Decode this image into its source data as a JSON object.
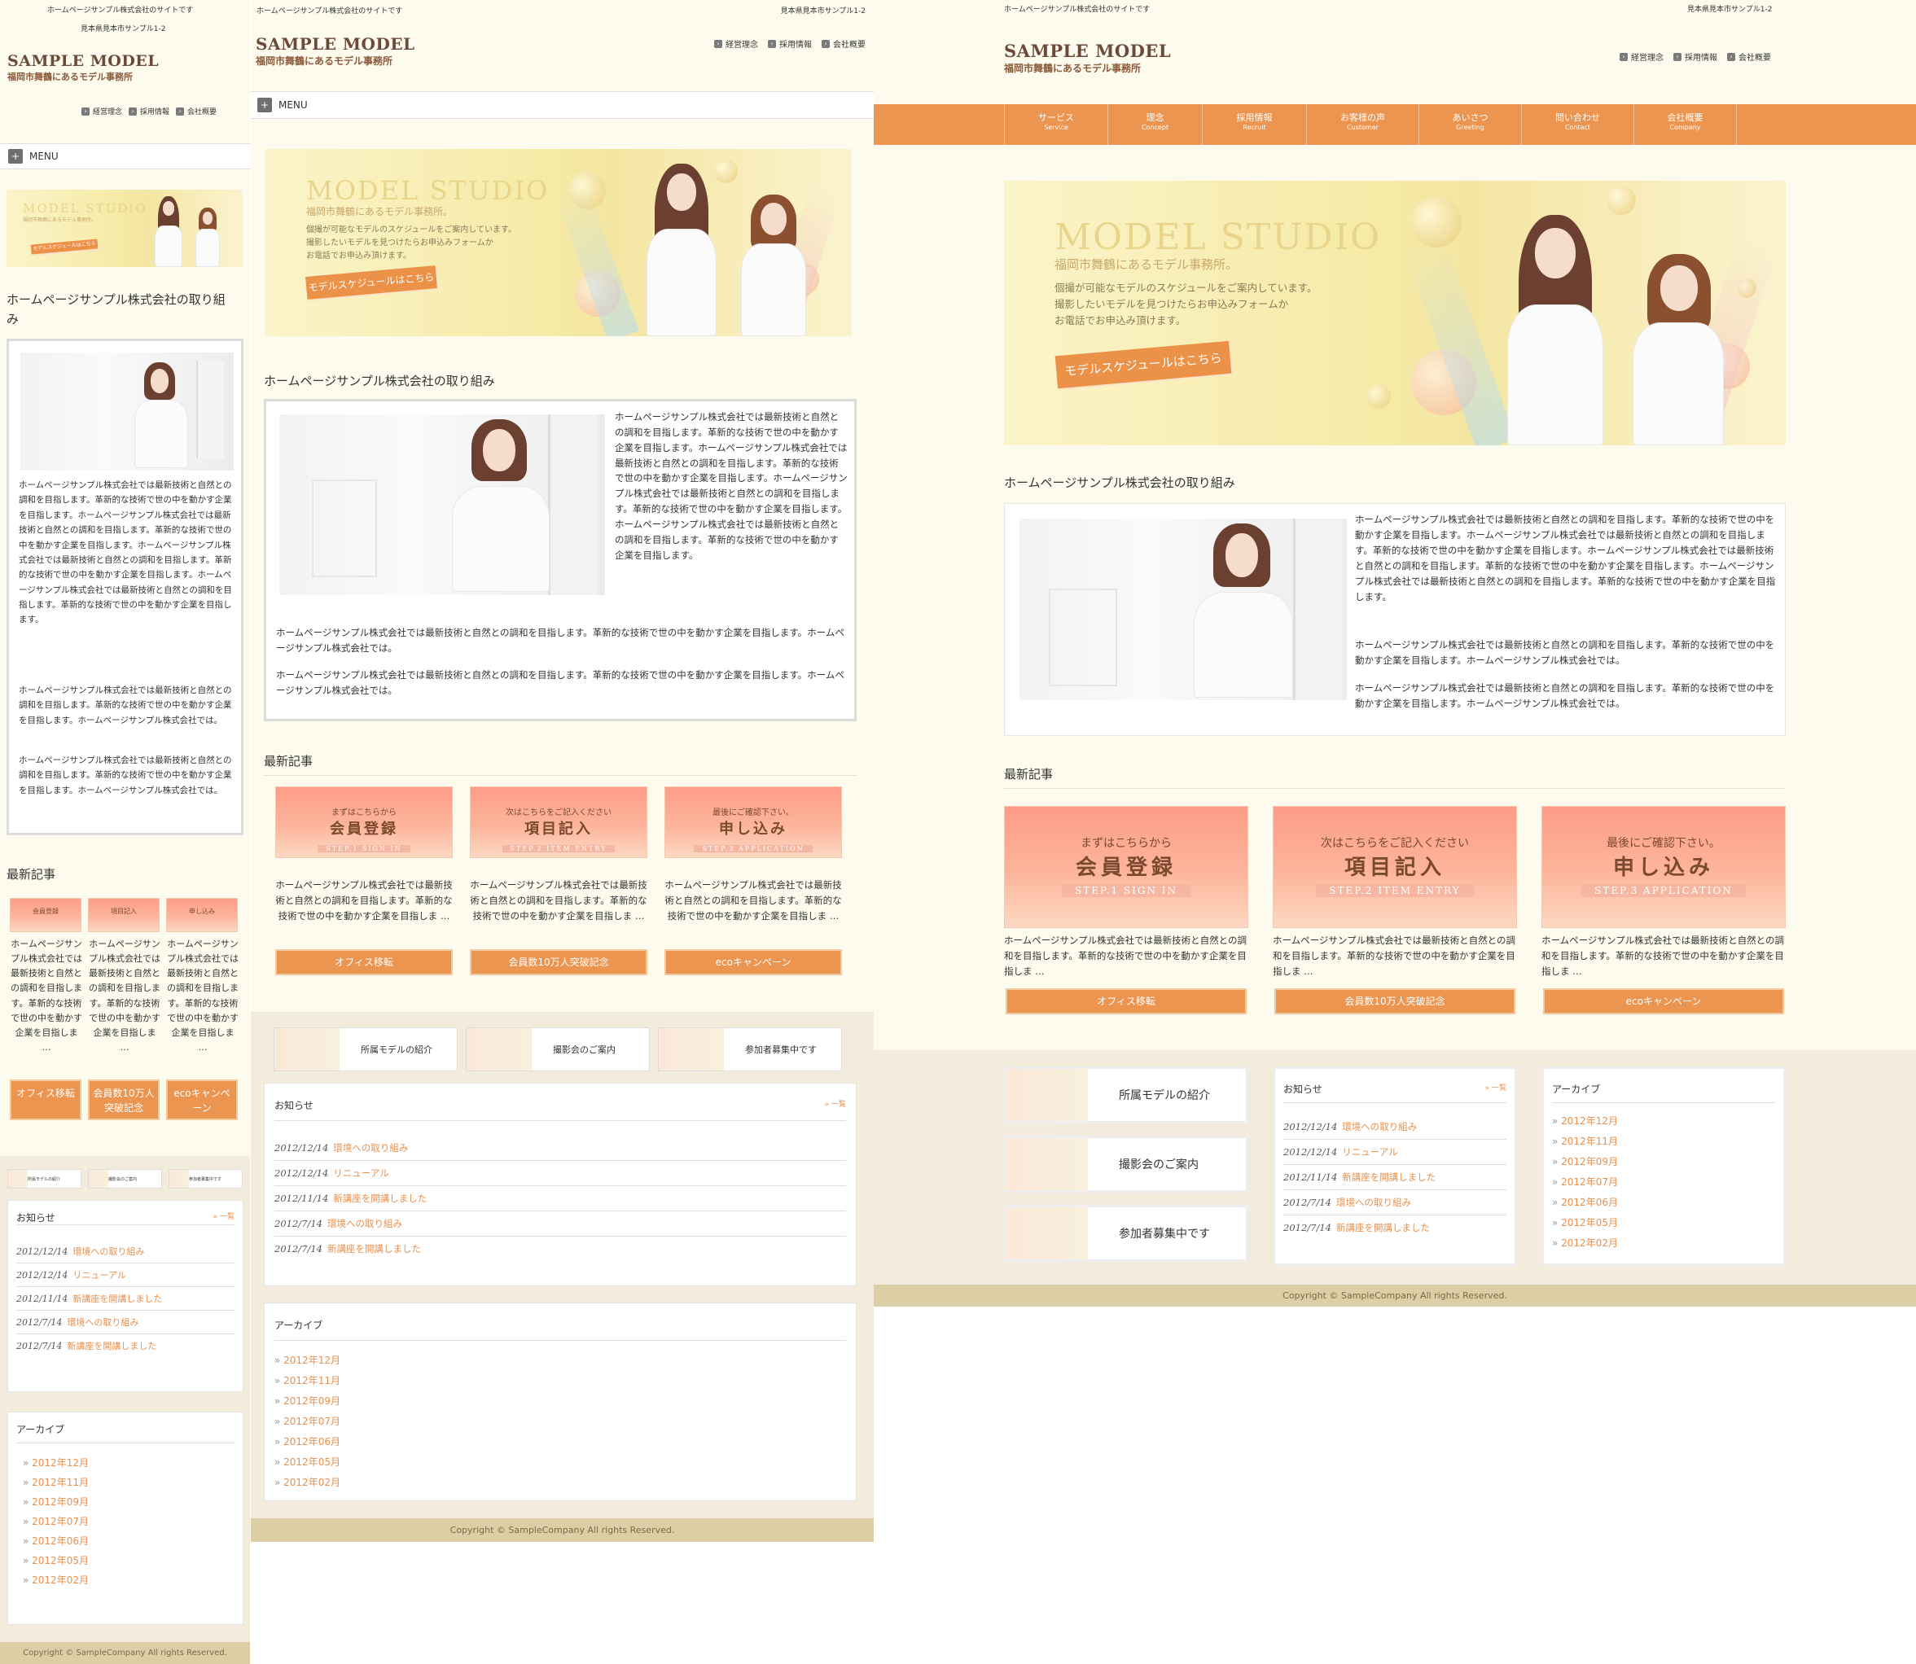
{
  "site": {
    "tagline": "ホームページサンプル株式会社のサイトです",
    "address": "見本県見本市サンプル1-2",
    "logo_en": "SAMPLE MODEL",
    "logo_jp": "福岡市舞鶴にあるモデル事務所",
    "header_links": [
      "経営理念",
      "採用情報",
      "会社概要"
    ],
    "menu_label": "MENU"
  },
  "global_nav": [
    {
      "label": "サービス",
      "sub": "Service"
    },
    {
      "label": "理念",
      "sub": "Concept"
    },
    {
      "label": "採用情報",
      "sub": "Recruit"
    },
    {
      "label": "お客様の声",
      "sub": "Customer"
    },
    {
      "label": "あいさつ",
      "sub": "Greeting"
    },
    {
      "label": "問い合わせ",
      "sub": "Contact"
    },
    {
      "label": "会社概要",
      "sub": "Company"
    }
  ],
  "banner": {
    "title": "MODEL STUDIO",
    "subtitle": "福岡市舞鶴にあるモデル事務所。",
    "desc1": "個撮が可能なモデルのスケジュールをご案内しています。",
    "desc2": "撮影したいモデルを見つけたらお申込みフォームか",
    "desc3": "お電話でお申込み頂けます。",
    "button": "モデルスケジュールはこちら"
  },
  "intro": {
    "heading": "ホームページサンプル株式会社の取り組み",
    "p1": "ホームページサンプル株式会社では最新技術と自然との調和を目指します。革新的な技術で世の中を動かす企業を目指します。ホームページサンプル株式会社では最新技術と自然との調和を目指します。革新的な技術で世の中を動かす企業を目指します。ホームページサンプル株式会社では最新技術と自然との調和を目指します。革新的な技術で世の中を動かす企業を目指します。ホームページサンプル株式会社では最新技術と自然との調和を目指します。革新的な技術で世の中を動かす企業を目指します。",
    "p2": "ホームページサンプル株式会社では最新技術と自然との調和を目指します。革新的な技術で世の中を動かす企業を目指します。ホームページサンプル株式会社では。",
    "p3": "ホームページサンプル株式会社では最新技術と自然との調和を目指します。革新的な技術で世の中を動かす企業を目指します。ホームページサンプル株式会社では。"
  },
  "latest": {
    "heading": "最新記事",
    "cards": [
      {
        "lead": "まずはこちらから",
        "title": "会員登録",
        "step": "STEP.1 SIGN IN",
        "text": "ホームページサンプル株式会社では最新技術と自然との調和を目指します。革新的な技術で世の中を動かす企業を目指しま …",
        "button": "オフィス移転"
      },
      {
        "lead": "次はこちらをご記入ください",
        "title": "項目記入",
        "step": "STEP.2 ITEM ENTRY",
        "text": "ホームページサンプル株式会社では最新技術と自然との調和を目指します。革新的な技術で世の中を動かす企業を目指しま …",
        "button": "会員数10万人突破記念"
      },
      {
        "lead": "最後にご確認下さい。",
        "title": "申し込み",
        "step": "STEP.3 APPLICATION",
        "text": "ホームページサンプル株式会社では最新技術と自然との調和を目指します。革新的な技術で世の中を動かす企業を目指しま …",
        "button": "ecoキャンペーン"
      }
    ]
  },
  "side_banners": [
    "所属モデルの紹介",
    "撮影会のご案内",
    "参加者募集中です"
  ],
  "news": {
    "heading": "お知らせ",
    "more": "» 一覧",
    "items": [
      {
        "date": "2012/12/14",
        "title": "環境への取り組み"
      },
      {
        "date": "2012/12/14",
        "title": "リニューアル"
      },
      {
        "date": "2012/11/14",
        "title": "新講座を開講しました"
      },
      {
        "date": "2012/7/14",
        "title": "環境への取り組み"
      },
      {
        "date": "2012/7/14",
        "title": "新講座を開講しました"
      }
    ]
  },
  "archive": {
    "heading": "アーカイブ",
    "items": [
      "2012年12月",
      "2012年11月",
      "2012年09月",
      "2012年07月",
      "2012年06月",
      "2012年05月",
      "2012年02月"
    ]
  },
  "copyright": "Copyright © SampleCompany All rights Reserved.",
  "colors": {
    "accent": "#ec9550",
    "background": "#fdfbee",
    "footer": "#dccfa6",
    "link": "#e8904e"
  }
}
